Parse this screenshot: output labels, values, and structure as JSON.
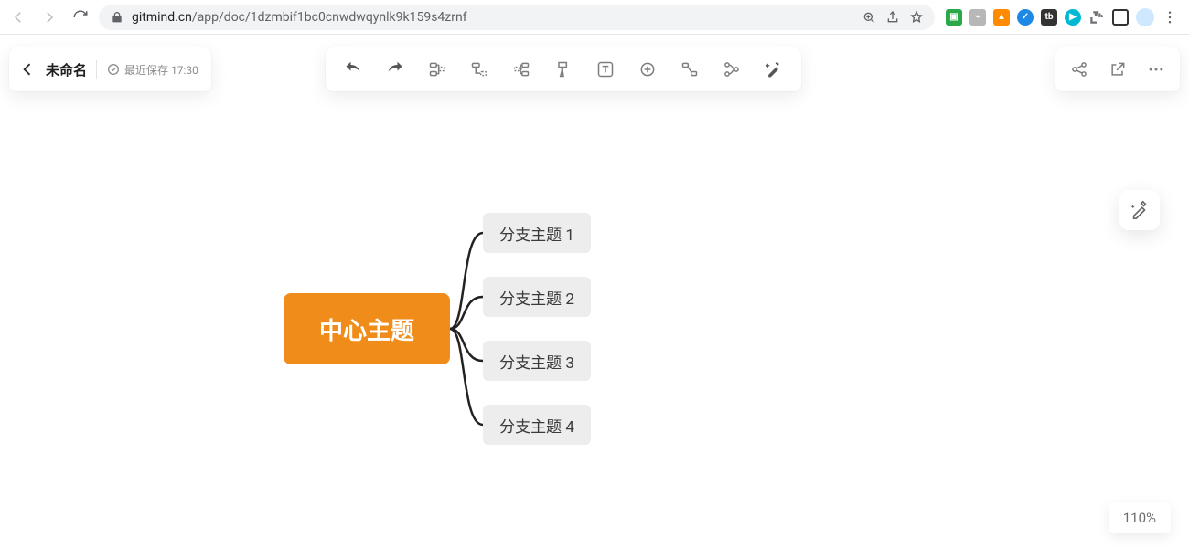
{
  "browser": {
    "url_domain": "gitmind.cn",
    "url_path": "/app/doc/1dzmbif1bc0cnwdwqynlk9k159s4zrnf"
  },
  "header": {
    "title": "未命名",
    "save_status": "最近保存 17:30"
  },
  "mindmap": {
    "central": "中心主题",
    "branches": [
      "分支主题 1",
      "分支主题 2",
      "分支主题 3",
      "分支主题 4"
    ]
  },
  "zoom": "110%"
}
